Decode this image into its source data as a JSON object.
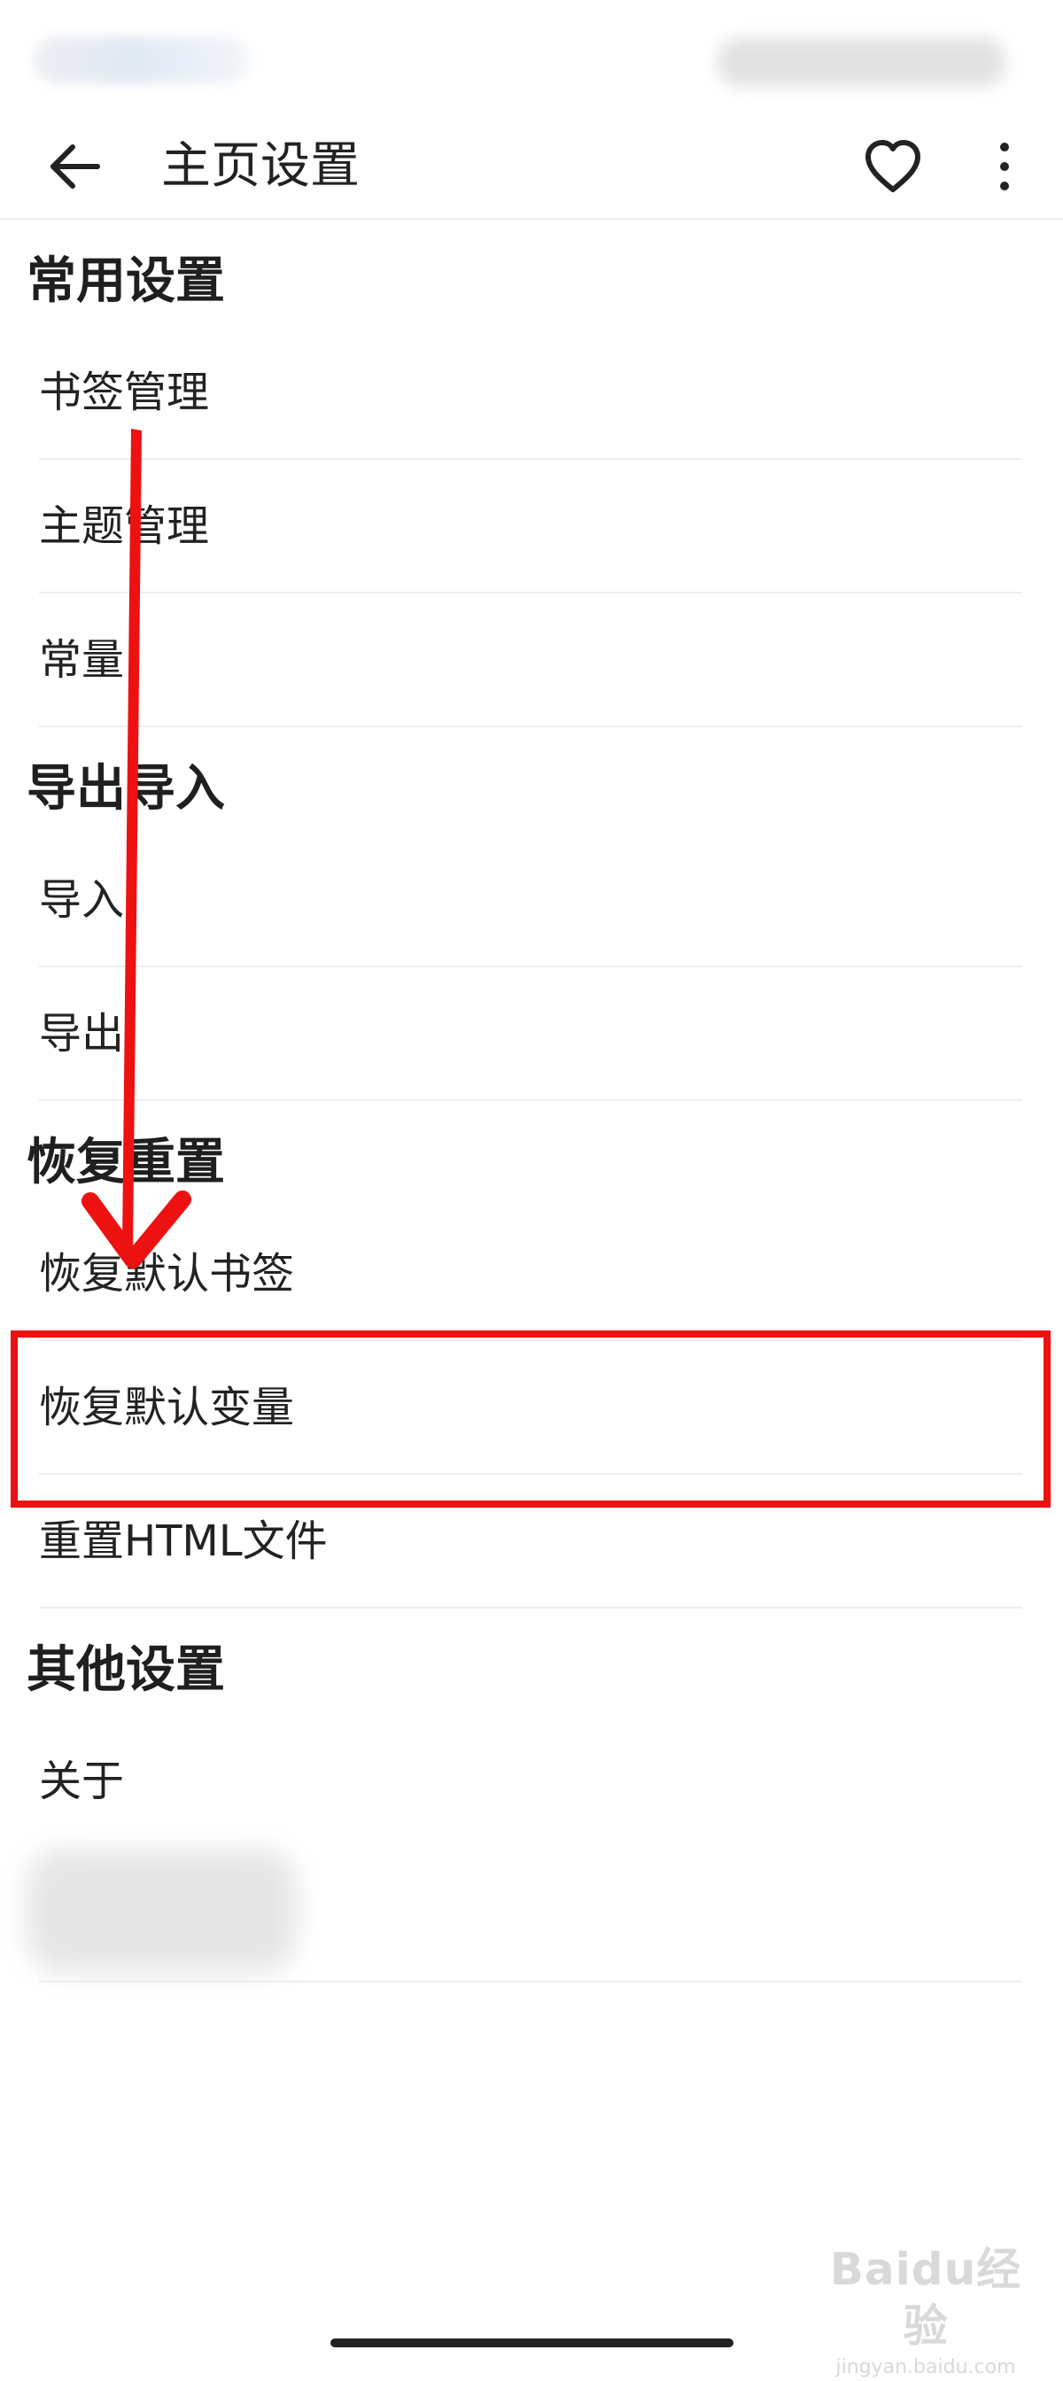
{
  "header": {
    "title": "主页设置",
    "back_icon": "arrow-left-icon",
    "favorite_icon": "heart-outline-icon",
    "more_icon": "more-vertical-icon"
  },
  "sections": [
    {
      "title": "常用设置",
      "items": [
        "书签管理",
        "主题管理",
        "常量"
      ]
    },
    {
      "title": "导出导入",
      "items": [
        "导入",
        "导出"
      ]
    },
    {
      "title": "恢复重置",
      "items": [
        "恢复默认书签",
        "恢复默认变量",
        "重置HTML文件"
      ]
    },
    {
      "title": "其他设置",
      "items": [
        "关于"
      ]
    }
  ],
  "annotation": {
    "color": "#ee1111",
    "highlighted_item": "恢复默认书签"
  },
  "watermark": {
    "main": "Baidu经验",
    "sub": "jingyan.baidu.com"
  }
}
